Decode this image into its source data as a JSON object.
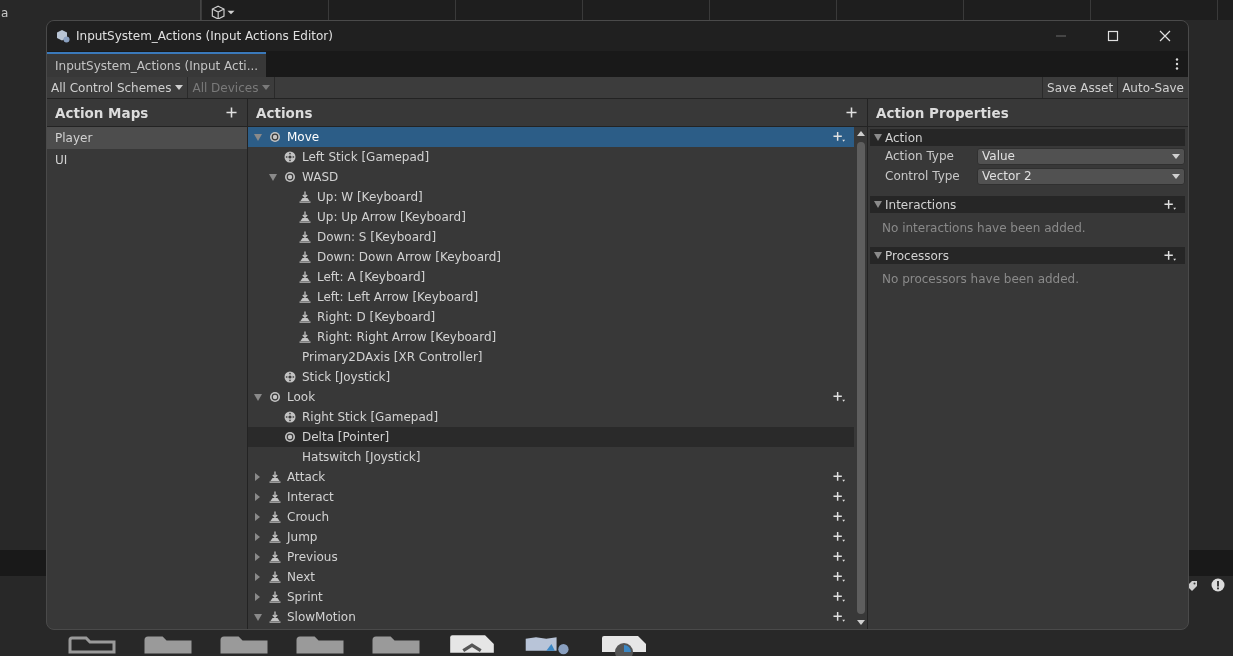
{
  "background": {
    "side_text": "a"
  },
  "window": {
    "title": "InputSystem_Actions (Input Actions Editor)",
    "tabs": [
      {
        "label": "InputSystem_Actions (Input Acti...",
        "selected": true
      }
    ]
  },
  "toolbar": {
    "control_schemes": {
      "label": "All Control Schemes",
      "disabled": false
    },
    "devices": {
      "label": "All Devices",
      "disabled": true
    },
    "buttons": [
      "Save Asset",
      "Auto-Save"
    ]
  },
  "action_maps": {
    "title": "Action Maps",
    "items": [
      {
        "label": "Player",
        "selected": true
      },
      {
        "label": "UI",
        "selected": false
      }
    ]
  },
  "actions": {
    "title": "Actions",
    "items": [
      {
        "label": "Move",
        "kind": "value",
        "selected": true,
        "hovered": false,
        "expanded": true,
        "children": [
          {
            "label": "Left Stick [Gamepad]",
            "kind": "stick",
            "selected": false,
            "hovered": false
          },
          {
            "label": "WASD",
            "kind": "value",
            "selected": false,
            "hovered": false,
            "expanded": true,
            "children": [
              {
                "label": "Up: W [Keyboard]",
                "kind": "button",
                "selected": false,
                "hovered": false
              },
              {
                "label": "Up: Up Arrow [Keyboard]",
                "kind": "button",
                "selected": false,
                "hovered": false
              },
              {
                "label": "Down: S [Keyboard]",
                "kind": "button",
                "selected": false,
                "hovered": false
              },
              {
                "label": "Down: Down Arrow [Keyboard]",
                "kind": "button",
                "selected": false,
                "hovered": false
              },
              {
                "label": "Left: A [Keyboard]",
                "kind": "button",
                "selected": false,
                "hovered": false
              },
              {
                "label": "Left: Left Arrow [Keyboard]",
                "kind": "button",
                "selected": false,
                "hovered": false
              },
              {
                "label": "Right: D [Keyboard]",
                "kind": "button",
                "selected": false,
                "hovered": false
              },
              {
                "label": "Right: Right Arrow [Keyboard]",
                "kind": "button",
                "selected": false,
                "hovered": false
              }
            ]
          },
          {
            "label": "Primary2DAxis [XR Controller]",
            "kind": "none",
            "selected": false,
            "hovered": false
          },
          {
            "label": "Stick [Joystick]",
            "kind": "stick",
            "selected": false,
            "hovered": false
          }
        ]
      },
      {
        "label": "Look",
        "kind": "value",
        "selected": false,
        "hovered": false,
        "expanded": true,
        "children": [
          {
            "label": "Right Stick [Gamepad]",
            "kind": "stick",
            "selected": false,
            "hovered": false
          },
          {
            "label": "Delta [Pointer]",
            "kind": "value",
            "selected": false,
            "hovered": true
          },
          {
            "label": "Hatswitch [Joystick]",
            "kind": "none",
            "selected": false,
            "hovered": false
          }
        ]
      },
      {
        "label": "Attack",
        "kind": "button",
        "selected": false,
        "hovered": false,
        "expanded": false
      },
      {
        "label": "Interact",
        "kind": "button",
        "selected": false,
        "hovered": false,
        "expanded": false
      },
      {
        "label": "Crouch",
        "kind": "button",
        "selected": false,
        "hovered": false,
        "expanded": false
      },
      {
        "label": "Jump",
        "kind": "button",
        "selected": false,
        "hovered": false,
        "expanded": false
      },
      {
        "label": "Previous",
        "kind": "button",
        "selected": false,
        "hovered": false,
        "expanded": false
      },
      {
        "label": "Next",
        "kind": "button",
        "selected": false,
        "hovered": false,
        "expanded": false
      },
      {
        "label": "Sprint",
        "kind": "button",
        "selected": false,
        "hovered": false,
        "expanded": false
      },
      {
        "label": "SlowMotion",
        "kind": "button",
        "selected": false,
        "hovered": false,
        "expanded": true
      }
    ]
  },
  "properties": {
    "title": "Action Properties",
    "sections": [
      {
        "title": "Action",
        "expanded": true,
        "addable": false,
        "fields": [
          {
            "label": "Action Type",
            "value": "Value"
          },
          {
            "label": "Control Type",
            "value": "Vector 2"
          }
        ]
      },
      {
        "title": "Interactions",
        "expanded": true,
        "addable": true,
        "empty_text": "No interactions have been added."
      },
      {
        "title": "Processors",
        "expanded": true,
        "addable": true,
        "empty_text": "No processors have been added."
      }
    ]
  }
}
